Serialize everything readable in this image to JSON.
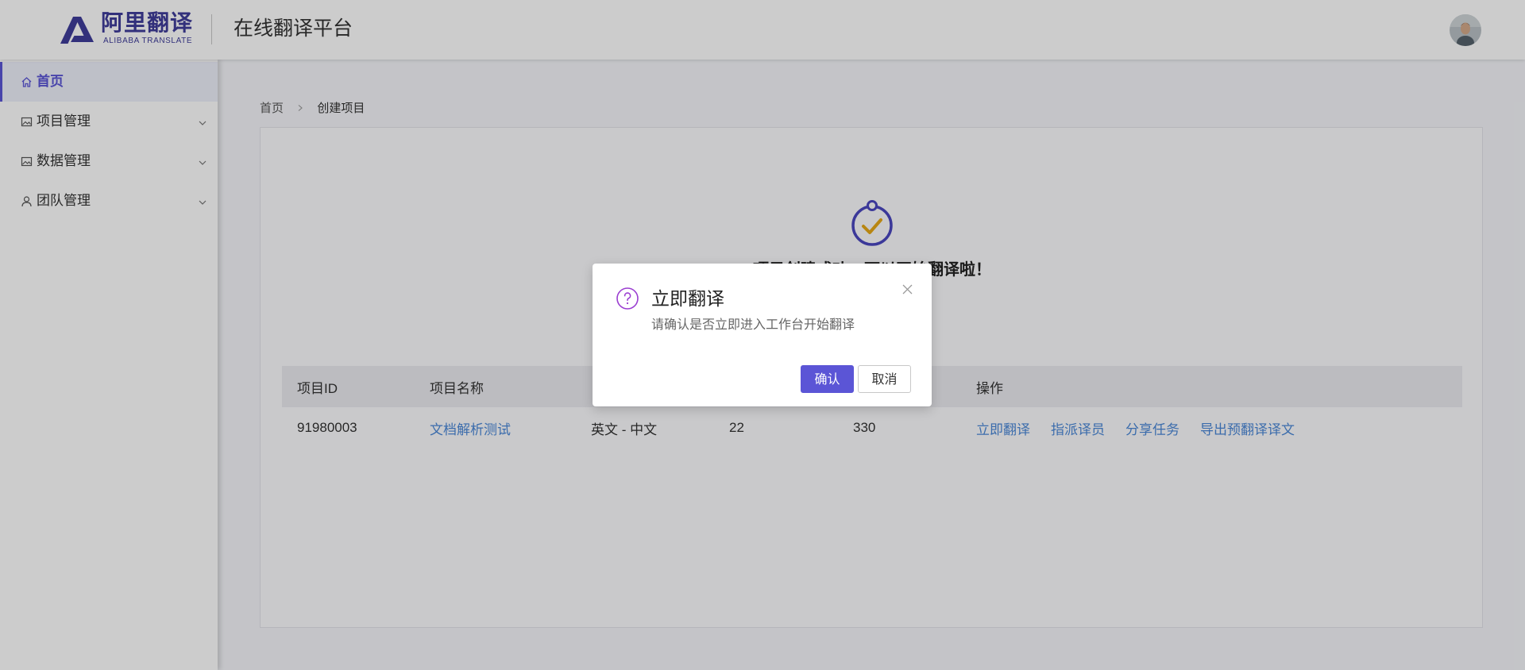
{
  "header": {
    "logo_cn": "阿里翻译",
    "logo_en": "ALIBABA TRANSLATE",
    "platform_title": "在线翻译平台",
    "avatar_icon": "user-avatar"
  },
  "sidebar": {
    "items": [
      {
        "label": "首页",
        "icon": "home-icon",
        "active": true,
        "expandable": false
      },
      {
        "label": "项目管理",
        "icon": "image-icon",
        "active": false,
        "expandable": true
      },
      {
        "label": "数据管理",
        "icon": "image-icon",
        "active": false,
        "expandable": true
      },
      {
        "label": "团队管理",
        "icon": "user-icon",
        "active": false,
        "expandable": true
      }
    ]
  },
  "breadcrumb": {
    "home": "首页",
    "current": "创建项目"
  },
  "result": {
    "icon": "success-badge-icon",
    "message": "项目创建成功，可以开始翻译啦！"
  },
  "table": {
    "columns": [
      "项目ID",
      "项目名称",
      "",
      "",
      "",
      "操作"
    ],
    "rows": [
      {
        "id": "91980003",
        "name": "文档解析测试",
        "languages": "英文 - 中文",
        "col4": "22",
        "col5": "330",
        "actions": [
          "立即翻译",
          "指派译员",
          "分享任务",
          "导出预翻译译文"
        ]
      }
    ]
  },
  "dialog": {
    "icon": "question-circle-icon",
    "title": "立即翻译",
    "message": "请确认是否立即进入工作台开始翻译",
    "confirm_label": "确认",
    "cancel_label": "取消"
  },
  "colors": {
    "accent": "#5b55d6",
    "link": "#4a88d8",
    "check": "#e6a817",
    "question": "#9b3fd1",
    "logo": "#3f3c9a"
  }
}
